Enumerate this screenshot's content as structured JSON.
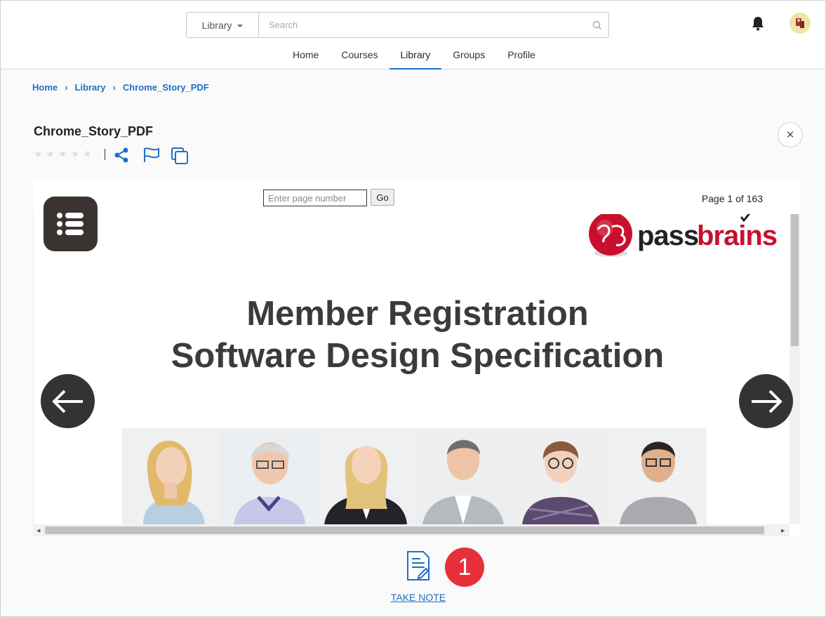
{
  "header": {
    "search_scope": "Library",
    "search_placeholder": "Search",
    "nav": [
      {
        "label": "Home"
      },
      {
        "label": "Courses"
      },
      {
        "label": "Library"
      },
      {
        "label": "Groups"
      },
      {
        "label": "Profile"
      }
    ],
    "active_nav": "Library"
  },
  "breadcrumb": [
    "Home",
    "Library",
    "Chrome_Story_PDF"
  ],
  "document": {
    "title": "Chrome_Story_PDF",
    "rating": 0,
    "rating_max": 5
  },
  "viewer": {
    "page_input_placeholder": "Enter page number",
    "go_label": "Go",
    "page_indicator": "Page 1 of 163",
    "logo_text": "passbrains",
    "slide_title_line1": "Member Registration",
    "slide_title_line2": "Software Design Specification"
  },
  "take_note": {
    "label": "TAKE NOTE",
    "badge": "1"
  },
  "colors": {
    "link_blue": "#1f6fc5",
    "badge_red": "#e8303a",
    "logo_red": "#c8102e"
  }
}
